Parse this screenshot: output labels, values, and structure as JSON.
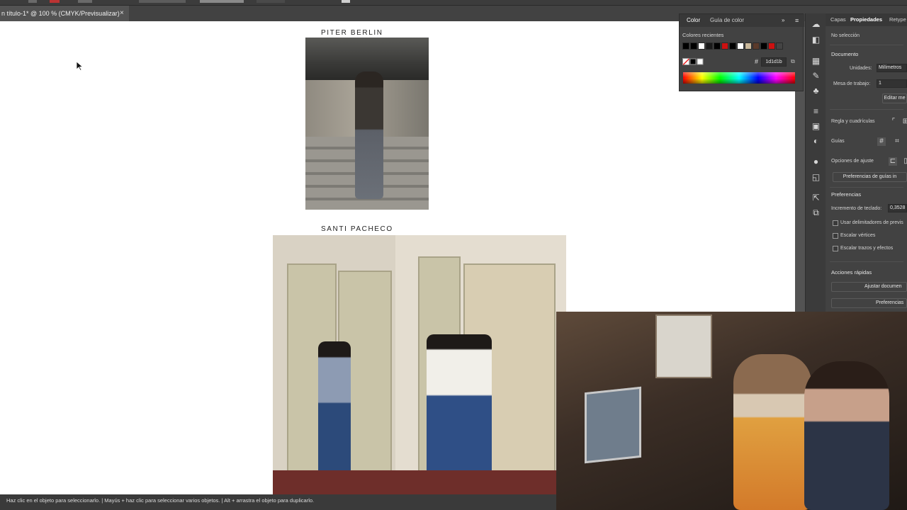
{
  "document": {
    "tab_title": "n título-1* @ 100 % (CMYK/Previsualizar)",
    "close_glyph": "×"
  },
  "artboard": {
    "artists": [
      {
        "name": "PITER BERLIN"
      },
      {
        "name": "SANTI PACHECO"
      }
    ]
  },
  "color_panel": {
    "tabs": [
      "Color",
      "Guía de color"
    ],
    "more_glyph": "»",
    "menu_glyph": "≡",
    "recent_colors_label": "Colores recientes",
    "recent_swatches": [
      "#000000",
      "#000000",
      "#ffffff",
      "#1a1a1a",
      "#000000",
      "#cc1111",
      "#000000",
      "#ffffff",
      "#c8b79a",
      "#5a3a2a",
      "#000000",
      "#cc1111",
      "#444444"
    ],
    "hex_symbol": "#",
    "hex_value": "1d1d1b"
  },
  "properties_panel": {
    "tabs": [
      "Capas",
      "Propiedades",
      "Retype"
    ],
    "selection_status": "No selección",
    "document_section": "Documento",
    "units_label": "Unidades:",
    "units_value": "Milímetros",
    "artboard_label": "Mesa de trabajo:",
    "artboard_value": "1",
    "edit_artboards_button": "Editar me",
    "rulers_grids_label": "Regla y cuadrículas",
    "guides_label": "Guías",
    "snap_options_label": "Opciones de ajuste",
    "guides_prefs_button": "Preferencias de guías in",
    "preferences_section": "Preferencias",
    "keyboard_increment_label": "Incremento de teclado:",
    "keyboard_increment_value": "0,3528",
    "checkboxes": [
      {
        "label": "Usar delimitadores de previs",
        "checked": false
      },
      {
        "label": "Escalar vértices",
        "checked": false
      },
      {
        "label": "Escalar trazos y efectos",
        "checked": false
      }
    ],
    "quick_actions_label": "Acciones rápidas",
    "fit_document_button": "Ajustar documen",
    "preferences_button": "Preferencias"
  },
  "status_bar": {
    "text": "Haz clic en el objeto para seleccionarlo.  |  Mayús + haz clic para seleccionar varios objetos.  |  Alt + arrastra el objeto para duplicarlo."
  },
  "icons": [
    "cursor-arrow-icon",
    "cc-libraries-icon",
    "properties-icon",
    "layers-icon",
    "symbols-icon",
    "brushes-icon",
    "stroke-icon",
    "gradient-icon",
    "transparency-icon",
    "appearance-icon",
    "graphic-styles-icon",
    "export-icon",
    "artboards-icon"
  ]
}
